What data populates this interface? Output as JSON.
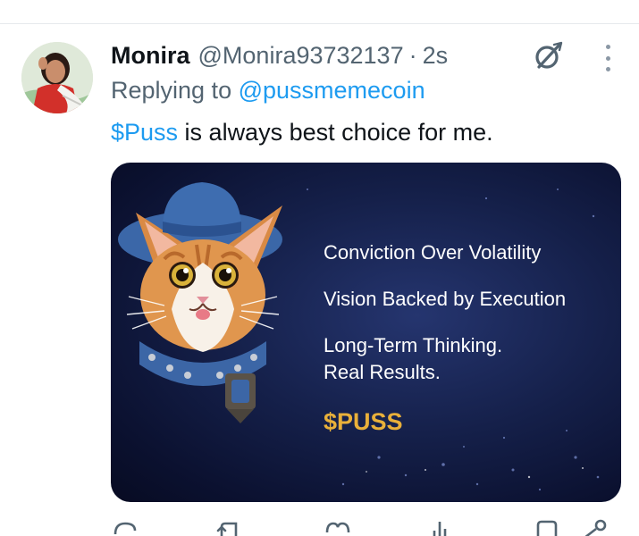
{
  "tweet": {
    "display_name": "Monira",
    "handle": "@Monira93732137",
    "separator": "·",
    "timestamp": "2s",
    "replying_prefix": "Replying to ",
    "replying_to": "@pussmemecoin",
    "text_cashtag": "$Puss",
    "text_rest": " is always best choice for me."
  },
  "media": {
    "line1": "Conviction Over Volatility",
    "line2": "Vision Backed by Execution",
    "line3a": "Long-Term Thinking.",
    "line3b": "Real Results.",
    "brand": "$PUSS",
    "brand_color": "#e9b03a"
  },
  "icons": {
    "header": [
      "grok-icon",
      "more-icon"
    ],
    "actions": [
      "reply-icon",
      "retweet-icon",
      "like-icon",
      "views-icon",
      "bookmark-icon",
      "share-icon"
    ]
  },
  "colors": {
    "link": "#1d9bf0",
    "secondary_text": "#536471",
    "primary_text": "#0f1419",
    "card_background": "#15204a"
  }
}
